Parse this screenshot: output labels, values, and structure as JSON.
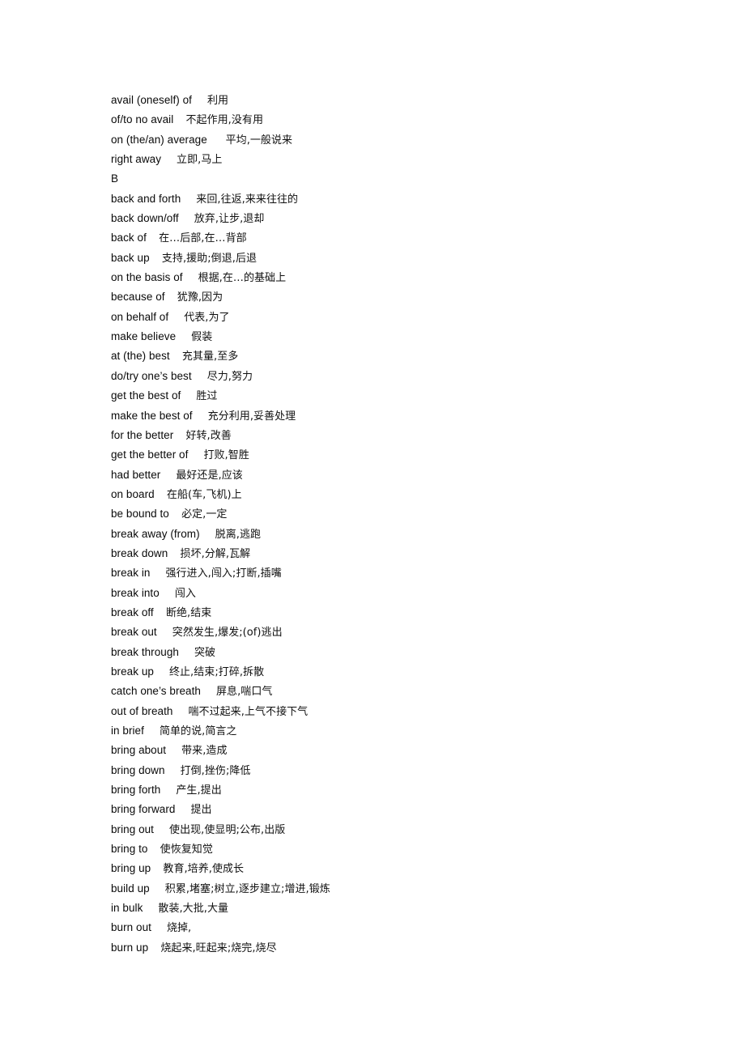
{
  "document": {
    "background_color": "#ffffff",
    "text_color": "#0a0a0a",
    "entries": [
      {
        "term": "avail (oneself) of",
        "gap": "     ",
        "gloss": "利用"
      },
      {
        "term": "of/to no avail",
        "gap": "    ",
        "gloss": "不起作用,没有用"
      },
      {
        "term": "on (the/an) average",
        "gap": "      ",
        "gloss": "平均,一般说来"
      },
      {
        "term": "right away",
        "gap": "     ",
        "gloss": "立即,马上"
      },
      {
        "term": "B",
        "gap": "",
        "gloss": ""
      },
      {
        "term": "back and forth",
        "gap": "     ",
        "gloss": "来回,往返,来来往往的"
      },
      {
        "term": "back down/off",
        "gap": "     ",
        "gloss": "放弃,让步,退却"
      },
      {
        "term": "back of",
        "gap": "    ",
        "gloss": "在…后部,在…背部"
      },
      {
        "term": "back up",
        "gap": "    ",
        "gloss": "支持,援助;倒退,后退"
      },
      {
        "term": "on the basis of",
        "gap": "     ",
        "gloss": "根据,在…的基础上"
      },
      {
        "term": "because of",
        "gap": "    ",
        "gloss": "犹豫,因为"
      },
      {
        "term": "on behalf of",
        "gap": "     ",
        "gloss": "代表,为了"
      },
      {
        "term": "make believe",
        "gap": "     ",
        "gloss": "假装"
      },
      {
        "term": "at (the) best",
        "gap": "    ",
        "gloss": "充其量,至多"
      },
      {
        "term": "do/try one’s best",
        "gap": "     ",
        "gloss": "尽力,努力"
      },
      {
        "term": "get the best of",
        "gap": "     ",
        "gloss": "胜过"
      },
      {
        "term": "make the best of",
        "gap": "     ",
        "gloss": "充分利用,妥善处理"
      },
      {
        "term": "for the better",
        "gap": "    ",
        "gloss": "好转,改善"
      },
      {
        "term": "get the better of",
        "gap": "     ",
        "gloss": "打败,智胜"
      },
      {
        "term": "had better",
        "gap": "     ",
        "gloss": "最好还是,应该"
      },
      {
        "term": "on board",
        "gap": "    ",
        "gloss": "在船(车,飞机)上"
      },
      {
        "term": "be bound to",
        "gap": "    ",
        "gloss": "必定,一定"
      },
      {
        "term": "break away (from)",
        "gap": "     ",
        "gloss": "脱离,逃跑"
      },
      {
        "term": "break down",
        "gap": "    ",
        "gloss": "损坏,分解,瓦解"
      },
      {
        "term": "break in",
        "gap": "     ",
        "gloss": "强行进入,闯入;打断,插嘴"
      },
      {
        "term": "break into",
        "gap": "     ",
        "gloss": "闯入"
      },
      {
        "term": "break off",
        "gap": "    ",
        "gloss": "断绝,结束"
      },
      {
        "term": "break out",
        "gap": "     ",
        "gloss": "突然发生,爆发;(of)逃出"
      },
      {
        "term": "break through",
        "gap": "     ",
        "gloss": "突破"
      },
      {
        "term": "break up",
        "gap": "     ",
        "gloss": "终止,结束;打碎,拆散"
      },
      {
        "term": "catch one’s breath",
        "gap": "     ",
        "gloss": "屏息,喘口气"
      },
      {
        "term": "out of breath",
        "gap": "     ",
        "gloss": "喘不过起来,上气不接下气"
      },
      {
        "term": "in brief",
        "gap": "     ",
        "gloss": "简单的说,简言之"
      },
      {
        "term": "bring about",
        "gap": "     ",
        "gloss": "带来,造成"
      },
      {
        "term": "bring down",
        "gap": "     ",
        "gloss": "打倒,挫伤;降低"
      },
      {
        "term": "bring forth",
        "gap": "     ",
        "gloss": "产生,提出"
      },
      {
        "term": "bring forward",
        "gap": "     ",
        "gloss": "提出"
      },
      {
        "term": "bring out",
        "gap": "     ",
        "gloss": "使出现,使显明;公布,出版"
      },
      {
        "term": "bring to",
        "gap": "    ",
        "gloss": "使恢复知觉"
      },
      {
        "term": "bring up",
        "gap": "    ",
        "gloss": "教育,培养,使成长"
      },
      {
        "term": "build up",
        "gap": "     ",
        "gloss": "积累,堵塞;树立,逐步建立;增进,锻炼"
      },
      {
        "term": "in bulk",
        "gap": "     ",
        "gloss": "散装,大批,大量"
      },
      {
        "term": "burn out",
        "gap": "     ",
        "gloss": "烧掉,"
      },
      {
        "term": "burn up",
        "gap": "    ",
        "gloss": "烧起来,旺起来;烧完,烧尽"
      }
    ]
  }
}
